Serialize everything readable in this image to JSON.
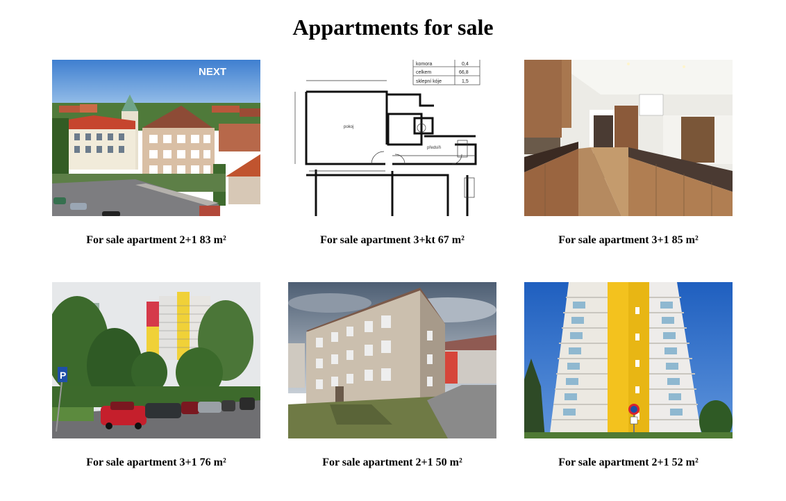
{
  "page": {
    "title": "Appartments for sale"
  },
  "listings": [
    {
      "caption": "For sale apartment 2+1 83 m²",
      "photo": "villa-street-aerial",
      "watermark": "NEXT"
    },
    {
      "caption": "For sale apartment 3+kt 67 m²",
      "photo": "floor-plan",
      "table": [
        [
          "komora",
          "0,4"
        ],
        [
          "celkem",
          "66,8"
        ],
        [
          "sklepní kóje",
          "1,5"
        ]
      ]
    },
    {
      "caption": "For sale apartment 3+1 85 m²",
      "photo": "kitchen-interior"
    },
    {
      "caption": "For sale apartment 3+1 76 m²",
      "photo": "high-rise-parking"
    },
    {
      "caption": "For sale apartment 2+1 50 m²",
      "photo": "three-storey-block"
    },
    {
      "caption": "For sale apartment 2+1 52 m²",
      "photo": "yellow-tower-block"
    }
  ]
}
